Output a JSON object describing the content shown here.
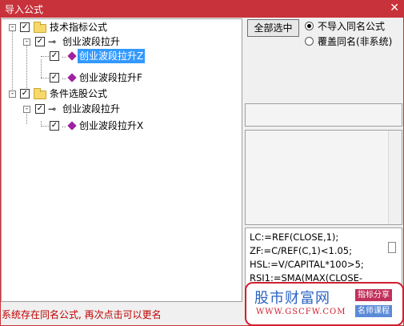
{
  "window": {
    "title": "导入公式",
    "close_label": "✕"
  },
  "tree": {
    "nodes": [
      {
        "id": "n1",
        "label": "技术指标公式",
        "checked": true,
        "expander": "-",
        "icon": "folder-icon"
      },
      {
        "id": "n2",
        "label": "创业波段拉升",
        "checked": true,
        "expander": "-",
        "icon": "key-icon"
      },
      {
        "id": "n3",
        "label": "创业波段拉升Z",
        "checked": true,
        "selected": true,
        "icon": "formula-gem-icon"
      },
      {
        "id": "n4",
        "label": "创业波段拉升F",
        "checked": true,
        "icon": "formula-gem-icon"
      },
      {
        "id": "n5",
        "label": "条件选股公式",
        "checked": true,
        "expander": "-",
        "icon": "folder-icon"
      },
      {
        "id": "n6",
        "label": "创业波段拉升",
        "checked": true,
        "expander": "-",
        "icon": "key-icon"
      },
      {
        "id": "n7",
        "label": "创业波段拉升X",
        "checked": true,
        "icon": "formula-gem-icon"
      }
    ]
  },
  "options": {
    "select_all_label": "全部选中",
    "radio_skip_label": "不导入同名公式",
    "radio_overwrite_label": "覆盖同名(非系统)",
    "selected_radio": "skip"
  },
  "code_preview": {
    "lines": [
      "LC:=REF(CLOSE,1);",
      "ZF:=C/REF(C,1)<1.05;",
      "HSL:=V/CAPITAL*100>5;",
      "RSI1:=SMA(MAX(CLOSE-"
    ]
  },
  "watermark": {
    "brand": "股市财富网",
    "url": "WWW.GSCFW.COM",
    "tag_top": "指标分享",
    "tag_bottom": "名师课程"
  },
  "status_text": "系统存在同名公式, 再次点击可以更名",
  "colors": {
    "titlebar": "#c8323a",
    "selection": "#3399ff",
    "status": "#c00000"
  }
}
